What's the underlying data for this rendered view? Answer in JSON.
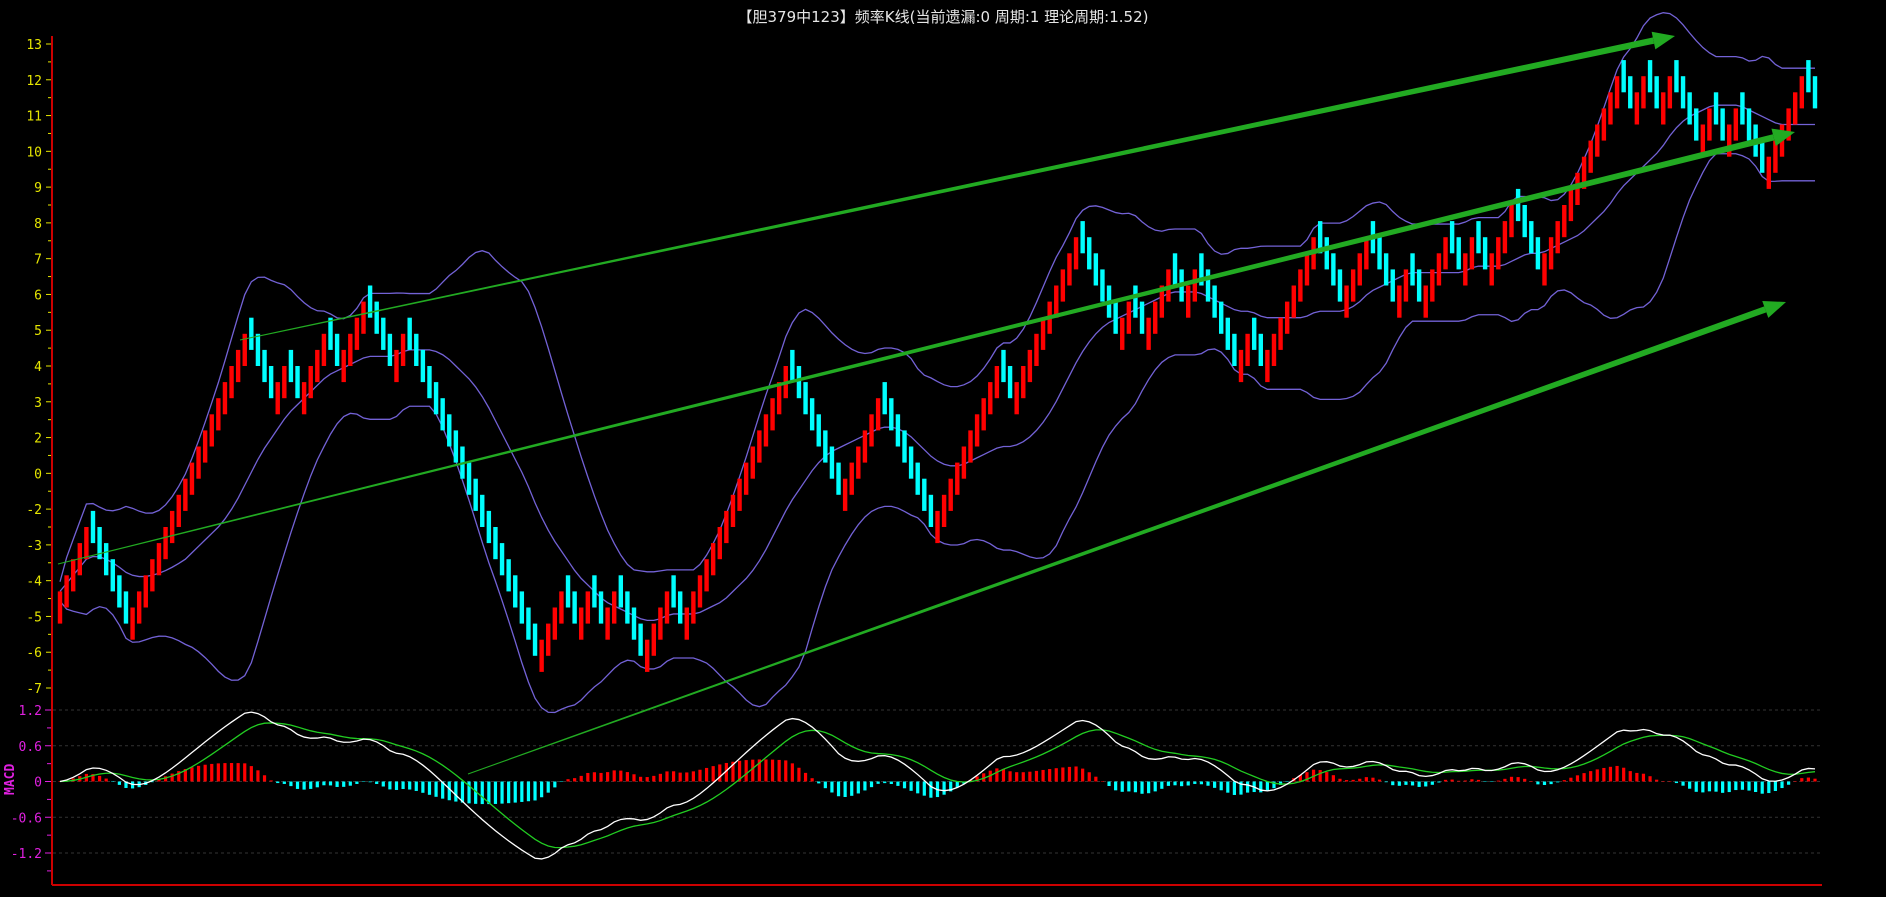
{
  "title": "【胆379中123】频率K线(当前遗漏:0 周期:1 理论周期:1.52)",
  "colors": {
    "up": "#ff0000",
    "down": "#00ffff",
    "band": "#7362d6",
    "dif": "#ffffff",
    "dea": "#22cc22",
    "axis": "#cc0000",
    "trend": "#22aa22",
    "main_label": "#e6e600",
    "macd_label": "#e020e0"
  },
  "chart_data": [
    {
      "type": "candlestick",
      "title": "频率K线",
      "y_tick_labels": [
        "13",
        "12",
        "11",
        "10",
        "9",
        "8",
        "7",
        "6",
        "5",
        "4",
        "3",
        "2",
        "0",
        "-2",
        "-3",
        "-4",
        "-5",
        "-6",
        "-7"
      ],
      "ylim": [
        -7,
        13
      ],
      "brick_step": 0.5,
      "pivot_levels": [
        -4,
        -2,
        -5,
        4,
        2,
        3,
        2,
        4,
        3,
        5,
        3,
        4,
        -6,
        -4,
        -5,
        -4,
        -5,
        -4,
        -6,
        -4,
        -5,
        3,
        -1,
        2,
        -2,
        3,
        2,
        3,
        7,
        4,
        5,
        4,
        6,
        5,
        6,
        3,
        4,
        3,
        7,
        5,
        7,
        5,
        6,
        5,
        7,
        6,
        7,
        6,
        8,
        6,
        12,
        11,
        12,
        11,
        12,
        10,
        11,
        10,
        11,
        9,
        12,
        11
      ],
      "overlays": {
        "bollinger_period": 20,
        "bollinger_k": 2
      },
      "trend_lines": 3
    },
    {
      "type": "line",
      "title": "MACD",
      "label": "MACD",
      "y_tick_labels": [
        "1.2",
        "0.6",
        "0",
        "-0.6",
        "-1.2"
      ],
      "ylim": [
        -1.4,
        1.3
      ],
      "params": {
        "fast": 12,
        "slow": 26,
        "signal": 9
      },
      "series": [
        {
          "name": "DIF"
        },
        {
          "name": "DEA"
        },
        {
          "name": "MACD histogram"
        }
      ]
    }
  ]
}
